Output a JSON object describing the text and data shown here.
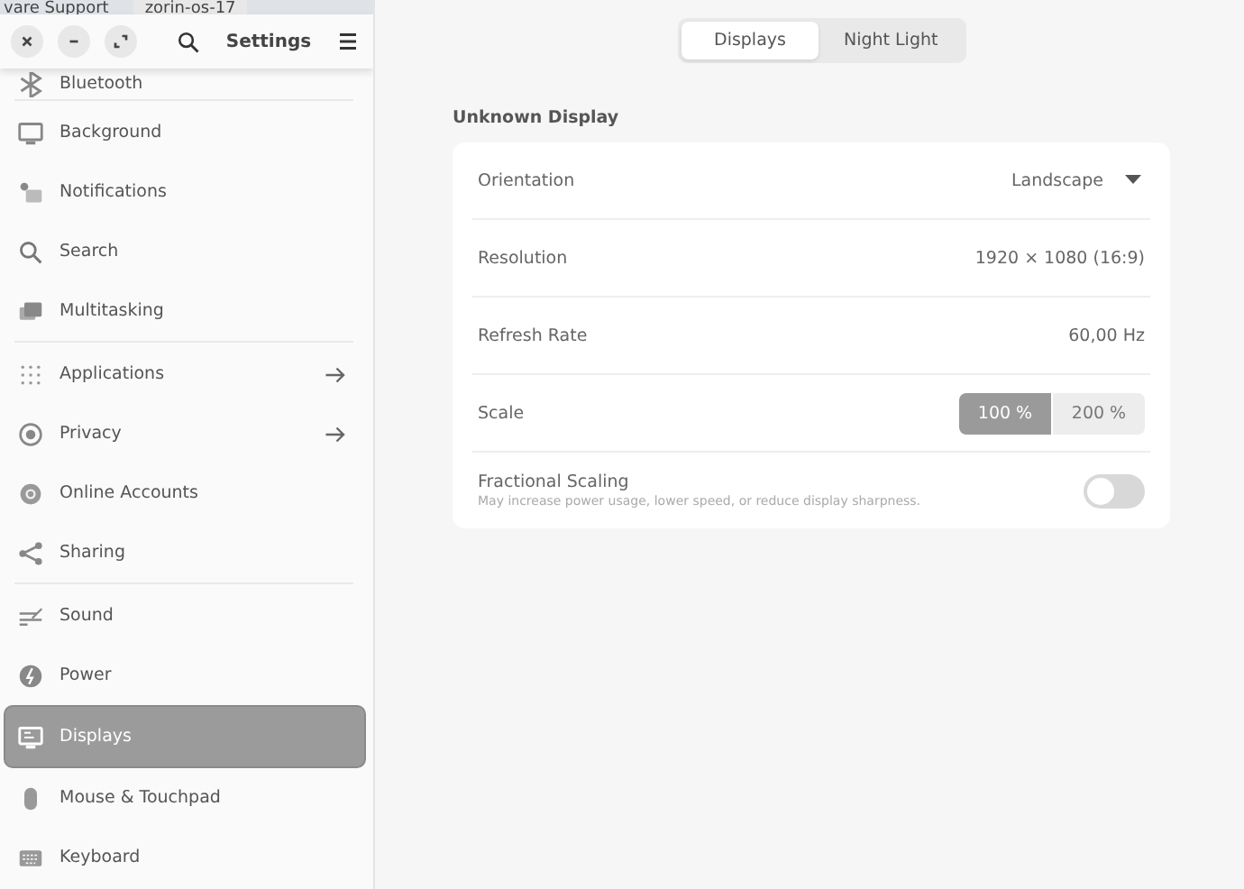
{
  "background_window": {
    "texts": [
      "vare Support",
      "zorin-os-17"
    ]
  },
  "header": {
    "title": "Settings"
  },
  "sidebar": {
    "groups": [
      {
        "items": [
          {
            "label": "Bluetooth",
            "kind": "bluetooth",
            "arrow": false,
            "selected": false
          }
        ]
      },
      {
        "items": [
          {
            "label": "Background",
            "kind": "monitor",
            "arrow": false,
            "selected": false
          },
          {
            "label": "Notifications",
            "kind": "bell",
            "arrow": false,
            "selected": false
          },
          {
            "label": "Search",
            "kind": "search",
            "arrow": false,
            "selected": false
          },
          {
            "label": "Multitasking",
            "kind": "windows",
            "arrow": false,
            "selected": false
          }
        ]
      },
      {
        "items": [
          {
            "label": "Applications",
            "kind": "grid",
            "arrow": true,
            "selected": false
          },
          {
            "label": "Privacy",
            "kind": "circle",
            "arrow": true,
            "selected": false
          },
          {
            "label": "Online Accounts",
            "kind": "at",
            "arrow": false,
            "selected": false
          },
          {
            "label": "Sharing",
            "kind": "share",
            "arrow": false,
            "selected": false
          }
        ]
      },
      {
        "items": [
          {
            "label": "Sound",
            "kind": "sliders",
            "arrow": false,
            "selected": false
          },
          {
            "label": "Power",
            "kind": "power",
            "arrow": false,
            "selected": false
          },
          {
            "label": "Displays",
            "kind": "display",
            "arrow": false,
            "selected": true
          },
          {
            "label": "Mouse & Touchpad",
            "kind": "mouse",
            "arrow": false,
            "selected": false
          },
          {
            "label": "Keyboard",
            "kind": "keyboard",
            "arrow": false,
            "selected": false
          }
        ]
      }
    ]
  },
  "tabs": [
    {
      "label": "Displays",
      "selected": true
    },
    {
      "label": "Night Light",
      "selected": false
    }
  ],
  "section_title": "Unknown Display",
  "rows": [
    {
      "kind": "dropdown",
      "label": "Orientation",
      "value": "Landscape"
    },
    {
      "kind": "value",
      "label": "Resolution",
      "value": "1920 × 1080 (16:9)"
    },
    {
      "kind": "value",
      "label": "Refresh Rate",
      "value": "60,00 Hz"
    },
    {
      "kind": "segmented",
      "label": "Scale",
      "options": [
        {
          "label": "100 %",
          "selected": true
        },
        {
          "label": "200 %",
          "selected": false
        }
      ]
    },
    {
      "kind": "switch",
      "label": "Fractional Scaling",
      "subtitle": "May increase power usage, lower speed, or reduce display sharpness.",
      "on": false
    }
  ]
}
